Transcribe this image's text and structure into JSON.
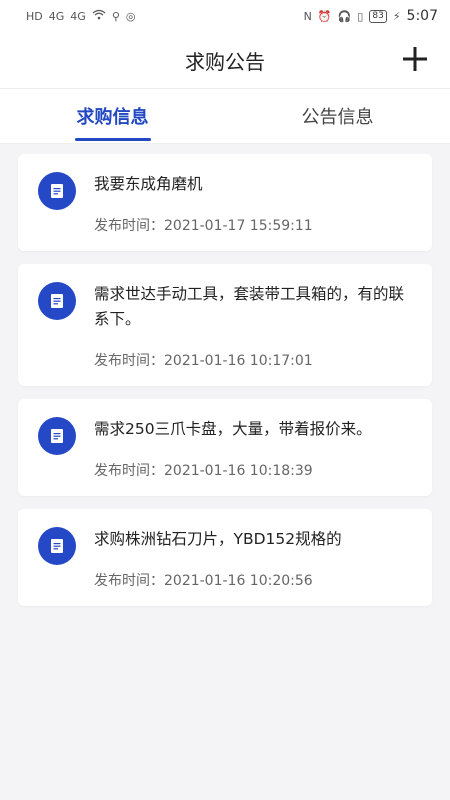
{
  "status_bar": {
    "left_indicators": [
      "HD",
      "4G",
      "4G"
    ],
    "battery": "83",
    "time": "5:07"
  },
  "header": {
    "title": "求购公告",
    "add_icon": "plus-icon"
  },
  "tabs": [
    {
      "label": "求购信息",
      "active": true
    },
    {
      "label": "公告信息",
      "active": false
    }
  ],
  "colors": {
    "accent": "#2248c2",
    "icon_bg": "#2548c6"
  },
  "posts": [
    {
      "text": "我要东成角磨机",
      "time_label": "发布时间：",
      "time": "2021-01-17 15:59:11"
    },
    {
      "text": "需求世达手动工具，套装带工具箱的，有的联系下。",
      "time_label": "发布时间：",
      "time": "2021-01-16 10:17:01"
    },
    {
      "text": "需求250三爪卡盘，大量，带着报价来。",
      "time_label": "发布时间：",
      "time": "2021-01-16 10:18:39"
    },
    {
      "text": "求购株洲钻石刀片，YBD152规格的",
      "time_label": "发布时间：",
      "time": "2021-01-16 10:20:56"
    }
  ]
}
